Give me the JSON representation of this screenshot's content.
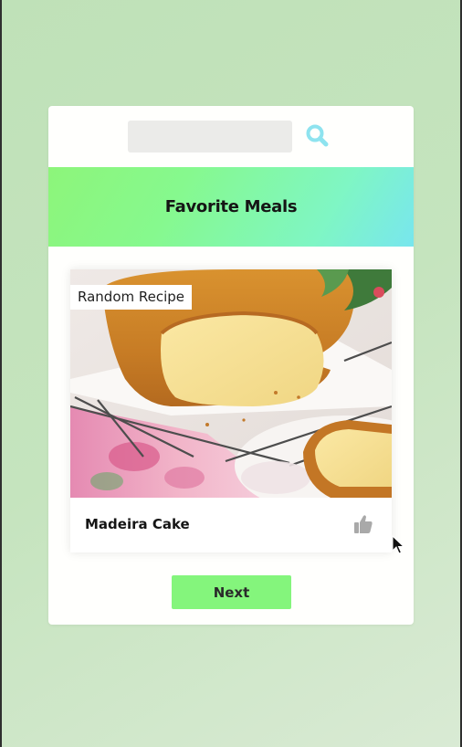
{
  "search": {
    "value": "",
    "placeholder": "",
    "button_icon": "search-icon",
    "icon_color": "#8ee3ef"
  },
  "header": {
    "title": "Favorite Meals",
    "gradient": [
      "#8df57a",
      "#78e6ee"
    ]
  },
  "meal": {
    "badge": "Random Recipe",
    "name": "Madeira Cake",
    "image_alt": "cake-photo",
    "favorite_icon": "thumbs-up-icon",
    "favorite_active": false
  },
  "actions": {
    "next_label": "Next",
    "next_color": "#84f57c"
  }
}
